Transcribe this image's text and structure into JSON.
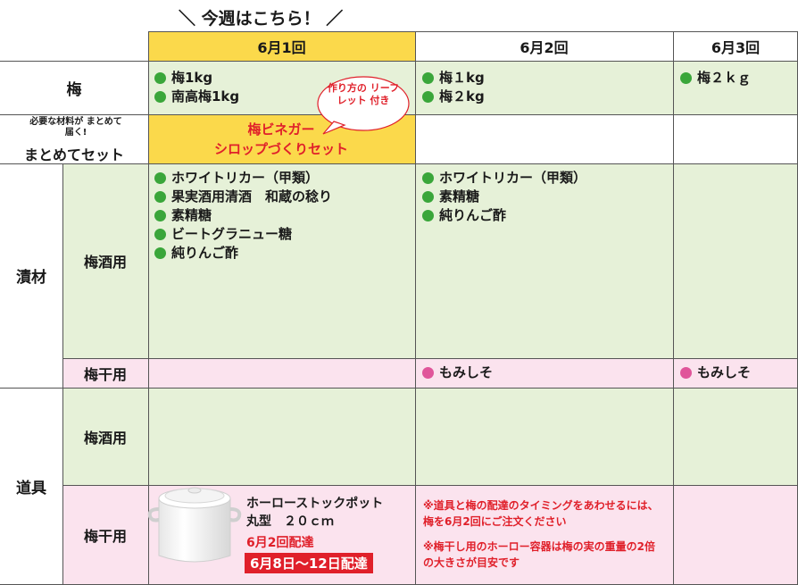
{
  "banner": "＼ 今週はこちら！ ／",
  "columns": [
    "6月1回",
    "6月2回",
    "6月3回"
  ],
  "rows": {
    "ume": {
      "label": "梅",
      "col1": [
        "梅1kg",
        "南高梅1kg"
      ],
      "col2": [
        "梅１kg",
        "梅２kg"
      ],
      "col3": [
        "梅２ｋｇ"
      ]
    },
    "set": {
      "label_sub": "必要な材料が まとめて届く!",
      "label_main": "まとめてセット",
      "product_line1": "梅ビネガー",
      "product_line2": "シロップづくりセット",
      "bubble": "作り方の リーフレット 付き"
    },
    "tsukezai": {
      "label": "漬材",
      "umeshu_label": "梅酒用",
      "umeshu_col1": [
        "ホワイトリカー（甲類）",
        "果実酒用清酒　和蔵の稔り",
        "素精糖",
        "ビートグラニュー糖",
        "純りんご酢"
      ],
      "umeshu_col2": [
        "ホワイトリカー（甲類）",
        "素精糖",
        "純りんご酢"
      ],
      "umeboshi_label": "梅干用",
      "umeboshi_col2": [
        "もみしそ"
      ],
      "umeboshi_col3": [
        "もみしそ"
      ]
    },
    "dougu": {
      "label": "道具",
      "umeshu_label": "梅酒用",
      "umeboshi_label": "梅干用",
      "pot_name": "ホーローストックポット",
      "pot_size": "丸型　２０ｃｍ",
      "pot_delivery": "6月2回配達",
      "pot_dates": "6月8日〜12日配達",
      "note1": "※道具と梅の配達のタイミングをあわせるには、梅を6月2回にご注文ください",
      "note2": "※梅干し用のホーロー容器は梅の実の重量の2倍の大きさが目安です"
    }
  },
  "colors": {
    "green_bg": "#e6f1d8",
    "pink_bg": "#fbe3ee",
    "yellow_bg": "#fbd94b",
    "green_dot": "#3aa63a",
    "pink_dot": "#e0559a",
    "red_text": "#e0202a"
  }
}
